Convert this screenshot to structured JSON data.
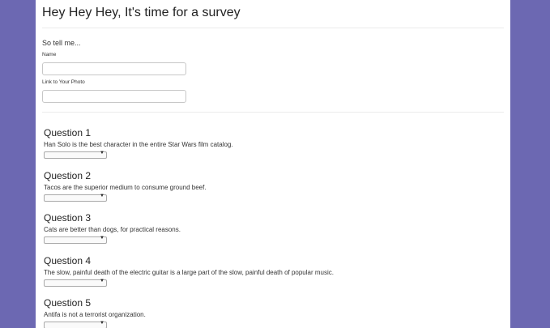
{
  "survey": {
    "title": "Hey Hey Hey, It's time for a survey",
    "intro": "So tell me...",
    "fields": [
      {
        "label": "Name",
        "value": "",
        "placeholder": ""
      },
      {
        "label": "Link to Your Photo",
        "value": "",
        "placeholder": ""
      }
    ]
  },
  "questions": [
    {
      "title": "Question 1",
      "text": "Han Solo is the best character in the entire Star Wars film catalog.",
      "selected": ""
    },
    {
      "title": "Question 2",
      "text": "Tacos are the superior medium to consume ground beef.",
      "selected": ""
    },
    {
      "title": "Question 3",
      "text": "Cats are better than dogs, for practical reasons.",
      "selected": ""
    },
    {
      "title": "Question 4",
      "text": "The slow, painful death of the electric guitar is a large part of the slow, painful death of popular music.",
      "selected": ""
    },
    {
      "title": "Question 5",
      "text": "Antifa is not a terrorist organization.",
      "selected": ""
    }
  ],
  "icons": {
    "dropdown": "chevron-down-icon"
  },
  "colors": {
    "background": "#6c68b2",
    "card": "#ffffff"
  }
}
